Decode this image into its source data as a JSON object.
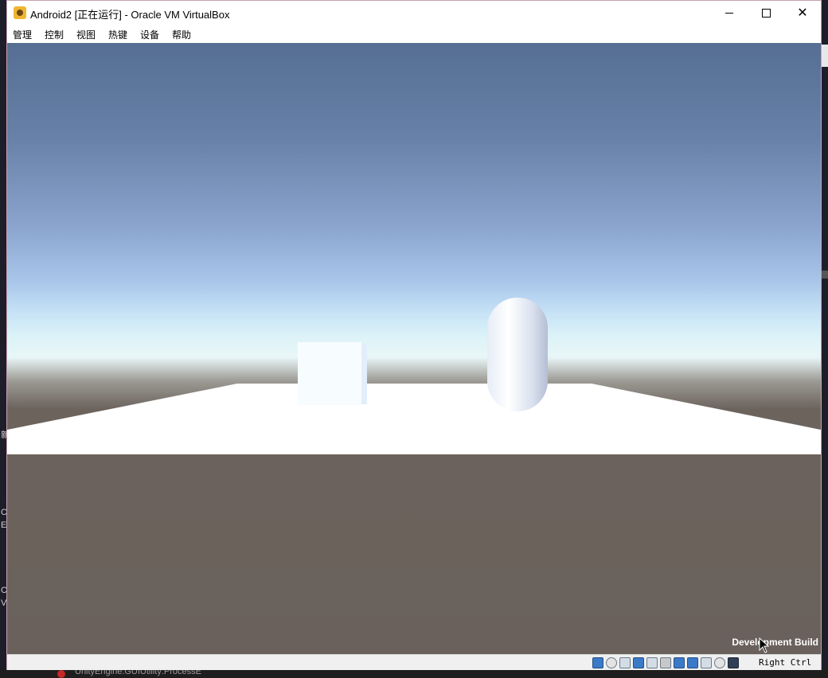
{
  "window": {
    "title": "Android2 [正在运行] - Oracle VM VirtualBox"
  },
  "menu": {
    "items": [
      "管理",
      "控制",
      "视图",
      "热键",
      "设备",
      "帮助"
    ]
  },
  "game": {
    "dev_build_label": "Development Build"
  },
  "statusbar": {
    "host_key": "Right Ctrl",
    "icons": [
      "hard-disk-icon",
      "optical-drive-icon",
      "audio-icon",
      "network-icon",
      "usb-icon",
      "shared-folders-icon",
      "display-icon",
      "video-capture-icon",
      "virtualization-icon",
      "mouse-integration-icon",
      "host-key-icon"
    ]
  },
  "background": {
    "log_text": "UnityEngine.GUIUtility:ProcessE",
    "left_glyphs": [
      "新",
      "C",
      "E",
      "C",
      "V"
    ]
  },
  "colors": {
    "sky_top": "#566e93",
    "horizon": "#e9f6f7",
    "ground": "#6a615c",
    "plane": "#ffffff"
  }
}
